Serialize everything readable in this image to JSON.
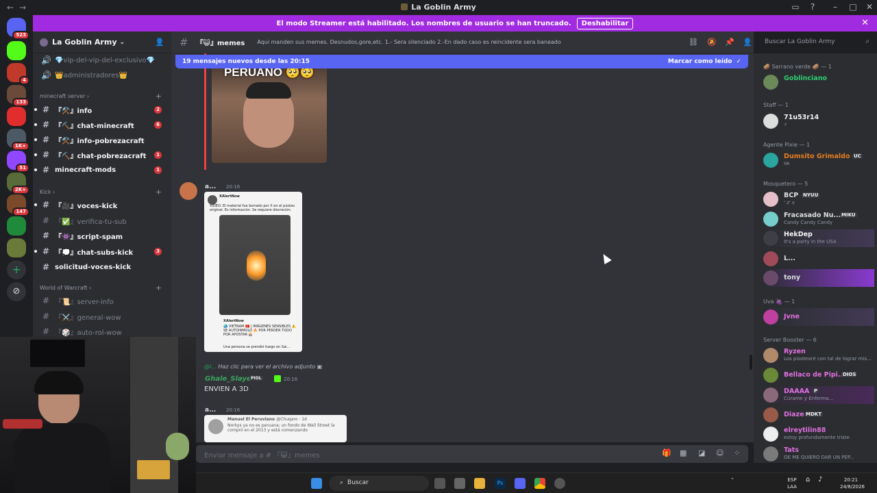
{
  "window": {
    "title": "La Goblin Army",
    "back_icon": "←",
    "fwd_icon": "→"
  },
  "banner": {
    "text": "El modo Streamer está habilitado. Los nombres de usuario se han truncado.",
    "button": "Deshabilitar"
  },
  "servers": {
    "badges": [
      "523",
      "4",
      "133",
      "1K+",
      "51",
      "2K+",
      "147"
    ]
  },
  "guild": {
    "name": "La Goblin Army"
  },
  "channels": {
    "top": [
      {
        "label": "💎vip-del-vip-del-exclusivo💎",
        "icon": "🔊"
      },
      {
        "label": "👑administradores👑",
        "icon": "🔊"
      }
    ],
    "cat1": "minecraft server",
    "cat1_items": [
      {
        "label": "『⚒️』info",
        "badge": "2"
      },
      {
        "label": "『⛏️』chat-minecraft",
        "badge": "6"
      },
      {
        "label": "『⚒️』info-pobrezacraft",
        "badge": ""
      },
      {
        "label": "『⛏️』chat-pobrezacraft",
        "badge": "1"
      },
      {
        "label": "minecraft-mods",
        "badge": "1"
      }
    ],
    "cat2": "Kick",
    "cat2_items": [
      {
        "label": "『🎥』voces-kick",
        "badge": ""
      },
      {
        "label": "『✅』verifica-tu-sub",
        "badge": ""
      },
      {
        "label": "『👾』script-spam",
        "badge": ""
      },
      {
        "label": "『💭』chat-subs-kick",
        "badge": "3"
      },
      {
        "label": "solicitud-voces-kick",
        "badge": ""
      }
    ],
    "cat3": "World of Warcraft",
    "cat3_items": [
      {
        "label": "『📜』server-info"
      },
      {
        "label": "『⚔️』general-wow"
      },
      {
        "label": "『🎲』auto-rol-wow"
      }
    ]
  },
  "channel": {
    "name": "『😺』memes",
    "topic": "Aqui manden sus memes. Desnudos,gore,etc. 1.- Sera silenciado 2.-En dado caso es reincidente sera baneado"
  },
  "search": {
    "placeholder": "Buscar La Goblin Army"
  },
  "newbar": {
    "text": "19 mensajes nuevos desde las 20:15",
    "mark": "Marcar como leído"
  },
  "messages": {
    "img1_caption": "PERUANO 🥺🥺",
    "m1_user": "a...",
    "m1_time": "20:16",
    "tweet_handle": "XAlertNow",
    "tweet_text": "VIDEO: El material fue borrado por X en el posteo original. Es información. Se requiere discreción.",
    "tweet_text2": "🌏 VIETNAM 🇻🇳 | IMÁGENES SENSIBLES ⚠️ SE AUTOINMOLÓ 🔥 POR PERDER TODO POR APOSTAR 🎰",
    "tweet_text3": "Una persona se prendió fuego en Sai...",
    "reply_text": "Haz clic para ver el archivo adjunto",
    "m2_user": "Ghale_Slayer",
    "m2_tag": "PIOL",
    "m2_time": "20:16",
    "m2_text": "ENVIEN A 3D",
    "m3_user": "a...",
    "m3_time": "20:16",
    "tweet2_name": "Manuel El Peruviano",
    "tweet2_handle": "@Chuqaro · 1d",
    "tweet2_text": "Norkys ya no es peruana; un fondo de Wall Street la compró en el 2013 y está comenzando"
  },
  "composer": {
    "placeholder": "Enviar mensaje a # 『😺』memes"
  },
  "members": {
    "g1": "🥔 Serrano verde 🥔 — 1",
    "g1_members": [
      {
        "name": "Goblinciano",
        "status": ""
      }
    ],
    "g2": "Staff — 1",
    "g2_members": [
      {
        "name": "71u53r14",
        "status": "⚡"
      }
    ],
    "g3": "Agente Pixie — 1",
    "g3_members": [
      {
        "name": "Dumsito Grimaldo ...",
        "status": "Ve",
        "tag": "UC"
      }
    ],
    "g4": "Mosquetero — 5",
    "g4_members": [
      {
        "name": "BCP",
        "status": "' z' s",
        "tag": "NYUU"
      },
      {
        "name": "Fracasado Nu...",
        "status": "Candy Candy Candy",
        "tag": "MIKU"
      },
      {
        "name": "HekDep",
        "status": "It's a party in the USA"
      },
      {
        "name": "L...",
        "status": ""
      },
      {
        "name": "tony",
        "status": ""
      }
    ],
    "g5": "Uva 🍇 — 1",
    "g5_members": [
      {
        "name": "Jvne",
        "status": ""
      }
    ],
    "g6": "Server Booster — 6",
    "g6_members": [
      {
        "name": "Ryzen",
        "status": "Los pisotearé con tal de lograr mis..."
      },
      {
        "name": "Bellaco de Pipi...",
        "status": "",
        "tag": "DIOS"
      },
      {
        "name": "DAAAA",
        "status": "Cúrame y Enferma...",
        "tag": "P"
      },
      {
        "name": "Diaze",
        "status": "",
        "tag": "MDKT"
      },
      {
        "name": "elreytilin88",
        "status": "estoy profundamente triste"
      },
      {
        "name": "Tats",
        "status": "OE ME QUIERO DAR UN PEP..."
      }
    ]
  },
  "taskbar": {
    "search": "Buscar",
    "lang1": "ESP",
    "lang2": "LAA",
    "time": "20:21",
    "date": "24/8/2026"
  },
  "colors": {
    "accent": "#5865f2",
    "streamer": "#a12be0",
    "badge": "#da373c"
  }
}
